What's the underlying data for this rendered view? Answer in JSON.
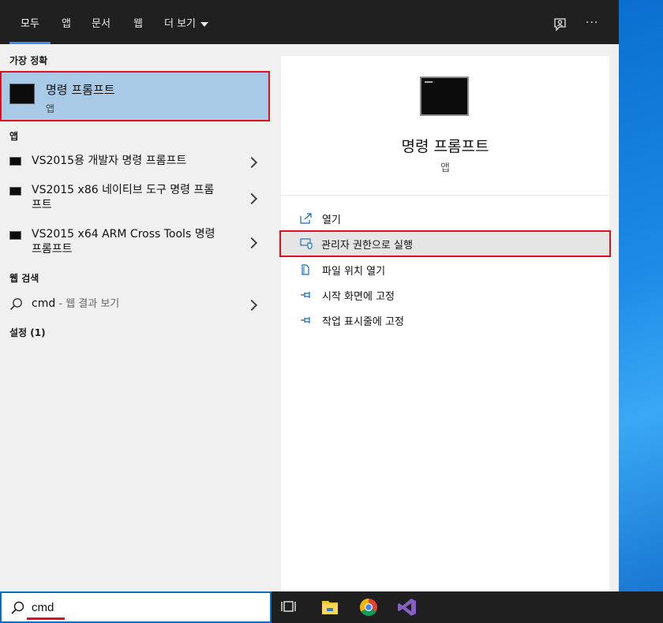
{
  "tabs": [
    {
      "label": "모두"
    },
    {
      "label": "앱"
    },
    {
      "label": "문서"
    },
    {
      "label": "웹"
    },
    {
      "label": "더 보기"
    }
  ],
  "header": {
    "more_label": "···"
  },
  "left": {
    "best_match_title": "가장 정확",
    "best": {
      "title": "명령 프롬프트",
      "subtitle": "앱"
    },
    "apps_title": "앱",
    "apps": [
      {
        "label": "VS2015용 개발자 명령 프롬프트"
      },
      {
        "label": "VS2015 x86 네이티브 도구 명령 프롬프트"
      },
      {
        "label": "VS2015 x64 ARM Cross Tools 명령 프롬프트"
      }
    ],
    "web_title": "웹 검색",
    "web": {
      "query": "cmd",
      "suffix": " - 웹 결과 보기"
    },
    "settings_title": "설정 (1)"
  },
  "right": {
    "name": "명령 프롬프트",
    "kind": "앱",
    "actions": [
      {
        "label": "열기",
        "icon": "open-icon"
      },
      {
        "label": "관리자 권한으로 실행",
        "icon": "shield-admin-icon"
      },
      {
        "label": "파일 위치 열기",
        "icon": "file-location-icon"
      },
      {
        "label": "시작 화면에 고정",
        "icon": "pin-icon"
      },
      {
        "label": "작업 표시줄에 고정",
        "icon": "pin-icon"
      }
    ]
  },
  "search": {
    "value": "cmd"
  },
  "colors": {
    "highlight": "#a8cae6",
    "accent": "#0f6cbd",
    "callout": "#e0111f",
    "topbar": "#202020"
  }
}
